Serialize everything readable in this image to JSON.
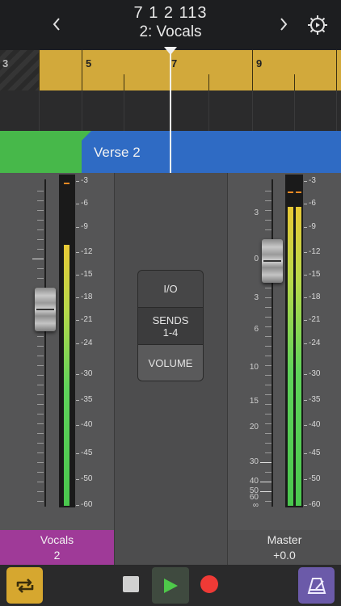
{
  "header": {
    "position": "7  1  2  113",
    "track_name": "2: Vocals",
    "back_icon": "chevron-left-icon",
    "forward_icon": "chevron-right-icon",
    "settings_icon": "gear-icon"
  },
  "ruler": {
    "bars": [
      "3",
      "5",
      "7",
      "9"
    ],
    "color": "#d2a93b"
  },
  "arrangement": {
    "section_label": "Verse 2",
    "section_color": "#2f6bc4",
    "prev_section_color": "#47b84a"
  },
  "mixer": {
    "meter_scale": [
      "-3",
      "-6",
      "-9",
      "-12",
      "-15",
      "-18",
      "-21",
      "-24",
      "-30",
      "-35",
      "-40",
      "-45",
      "-50",
      "-60"
    ],
    "fader_scale": [
      "3",
      "0",
      "3",
      "6",
      "10",
      "15",
      "20",
      "30",
      "40",
      "50",
      "60",
      "∞"
    ],
    "view_buttons": {
      "io": "I/O",
      "sends_line1": "SENDS",
      "sends_line2": "1-4",
      "volume": "VOLUME"
    },
    "channels": {
      "vocals": {
        "name": "Vocals",
        "number": "2",
        "color": "#9f3a98",
        "meter_level": 0.8
      },
      "master": {
        "name": "Master",
        "value": "+0.0",
        "meter_level_left": 0.93,
        "meter_level_right": 0.93
      }
    }
  },
  "transport": {
    "cycle_icon": "cycle-icon",
    "stop_icon": "stop-icon",
    "play_icon": "play-icon",
    "record_icon": "record-icon",
    "metronome_icon": "metronome-icon"
  }
}
